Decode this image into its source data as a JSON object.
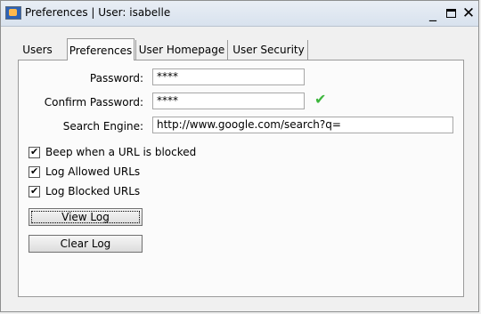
{
  "window": {
    "title": "Preferences | User: isabelle",
    "controls": {
      "minimize": "_",
      "close": "✕"
    }
  },
  "tabs": [
    {
      "label": "Users"
    },
    {
      "label": "Preferences",
      "active": true
    },
    {
      "label": "User Homepage"
    },
    {
      "label": "User Security"
    }
  ],
  "form": {
    "password_label": "Password:",
    "password_value": "****",
    "confirm_label": "Confirm Password:",
    "confirm_value": "****",
    "search_label": "Search Engine:",
    "search_value": "http://www.google.com/search?q="
  },
  "options": [
    {
      "label": "Beep when a URL is blocked",
      "checked": true
    },
    {
      "label": "Log Allowed URLs",
      "checked": true
    },
    {
      "label": "Log Blocked URLs",
      "checked": true
    }
  ],
  "buttons": {
    "view_log": "View Log",
    "clear_log": "Clear Log"
  },
  "colors": {
    "check_ok": "#3db63d",
    "titlebar": "#dfe7f1"
  }
}
